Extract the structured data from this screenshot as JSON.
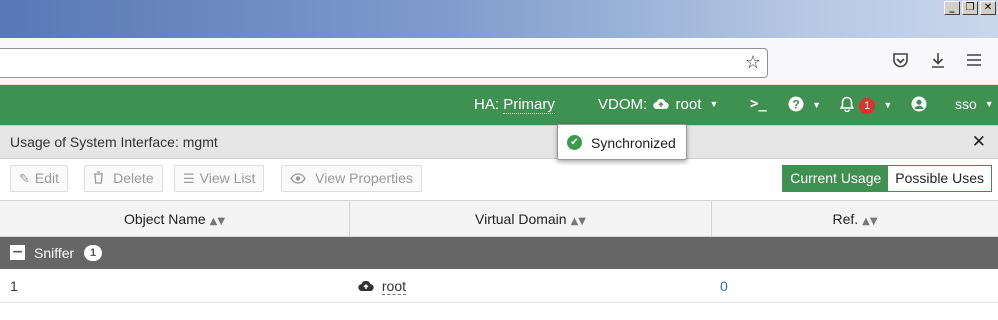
{
  "window": {
    "minimize": "_",
    "restore": "❐",
    "close": "✕"
  },
  "browser": {
    "star_icon": "bookmark-star-icon",
    "pocket_icon": "pocket-icon",
    "download_icon": "download-icon",
    "menu_icon": "hamburger-menu-icon"
  },
  "header": {
    "ha_label": "HA:",
    "ha_value": "Primary",
    "vdom_label": "VDOM:",
    "vdom_value": "root",
    "cli_glyph": ">_",
    "notification_count": "1",
    "user": "sso"
  },
  "toast": {
    "text": "Synchronized"
  },
  "dialog": {
    "title": "Usage of System Interface: mgmt",
    "toolbar": {
      "edit": "Edit",
      "delete": "Delete",
      "view_list": "View List",
      "view_properties": "View Properties"
    },
    "toggle": {
      "current": "Current Usage",
      "possible": "Possible Uses"
    }
  },
  "table": {
    "columns": [
      "Object Name",
      "Virtual Domain",
      "Ref."
    ],
    "group": {
      "label": "Sniffer",
      "count": "1"
    },
    "rows": [
      {
        "object_name": "1",
        "virtual_domain": "root",
        "ref": "0"
      }
    ]
  },
  "colors": {
    "brand_green": "#3e9150",
    "badge_red": "#e02f2f",
    "group_bg": "#666666"
  }
}
